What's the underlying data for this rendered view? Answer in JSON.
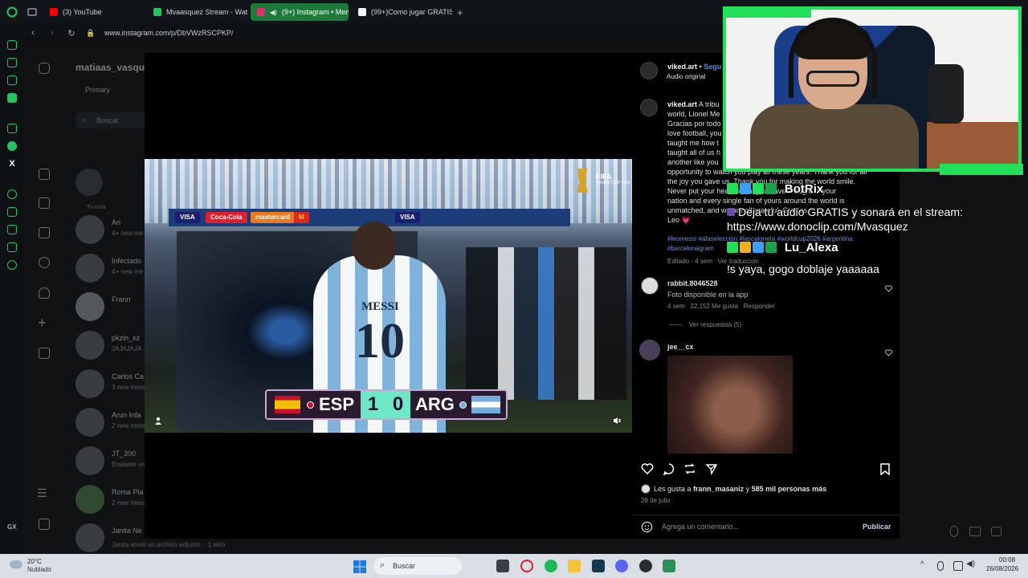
{
  "browser": {
    "tabs": [
      {
        "label": "(3) YouTube",
        "color": "#ff0000"
      },
      {
        "label": "Mvaasquez Stream - Watc",
        "color": "#22c55e"
      },
      {
        "label": "(9+) Instagram • Mens",
        "color": "#e1306c"
      },
      {
        "label": "(99+)Como jugar GRATIS a",
        "color": "#ffffff"
      }
    ],
    "new_tab": "+",
    "url": "www.instagram.com/p/DbVWzRSCPKP/",
    "gx_label": "GX"
  },
  "instagram_bg": {
    "username": "matiaas_vasqu",
    "primary_tab": "Primary",
    "search_placeholder": "Buscar",
    "note_label": "Tu nota",
    "conversations": [
      {
        "name": "Ari",
        "sub": "4+ new me"
      },
      {
        "name": "Infectado",
        "sub": "4+ new me"
      },
      {
        "name": "Frann",
        "sub": ""
      },
      {
        "name": "pkzin_xz",
        "sub": "JAJAJAJA"
      },
      {
        "name": "Carlos Ca",
        "sub": "3 new mess"
      },
      {
        "name": "Arun Infa",
        "sub": "2 new mess"
      },
      {
        "name": "JT_300",
        "sub": "Enviaste un"
      },
      {
        "name": "Roma Pla",
        "sub": "2 new mess"
      },
      {
        "name": "Janita Ne",
        "sub": ""
      }
    ],
    "bottom_text": "Janita envió un archivo adjunto. · 1 sem"
  },
  "video": {
    "ads": [
      "VISA",
      "Coca-Cola",
      "mastercard",
      "M",
      "VISA"
    ],
    "jersey_name": "MESSI",
    "jersey_number": "10",
    "fifa_logo": "FIFA",
    "fifa_sub": "WORLD CUP 2026",
    "scoreboard": {
      "home": "ESP",
      "away": "ARG",
      "home_score": "1",
      "away_score": "0"
    }
  },
  "post": {
    "author": "viked.art",
    "follow_label": "Segu",
    "audio": "Audio original",
    "caption_user": "viked.art",
    "caption_lines": [
      "A tribu",
      "world, Lionel Me",
      "Gracias por todo",
      "love football, you",
      "taught me how t",
      "taught all of us h",
      "another like you",
      "opportunity to watch you play all these years. Thank you for all",
      "the joy you gave us. Thank you for making the world smile.",
      "Never put your head down, you have brought to your",
      "nation and every single fan of yours around the world is",
      "unmatched, and we are all grateful. Gracias",
      "Leo 💗"
    ],
    "hashtags_line1": "#leomessi #afaseleccion #lascaloneta #worldcup2026 #argentina",
    "hashtags_line2": "#barcelonagram",
    "edited": "Editado · 4 sem",
    "translate": "Ver traducción",
    "comments": [
      {
        "user": "rabbit.8046528",
        "text": "Foto disponible en la app",
        "time": "4 sem",
        "likes": "22,152 Me gusta",
        "reply": "Responder",
        "view_replies": "Ver respuestas (5)"
      },
      {
        "user": "jee__cx"
      }
    ],
    "liked_by_prefix": "Les gusta a",
    "liked_by_user": "frann_masaniz",
    "liked_by_suffix": "y",
    "liked_by_count": "585 mil personas más",
    "date": "28 de julio",
    "comment_placeholder": "Agrega un comentario...",
    "publish": "Publicar"
  },
  "stream_overlay": {
    "chat": [
      {
        "type": "name",
        "text": "BotRix"
      },
      {
        "type": "msg",
        "text": "Deja tu audio GRATIS y sonará en el stream:"
      },
      {
        "type": "msg",
        "text": "https://www.donoclip.com/Mvasquez"
      },
      {
        "type": "name",
        "text": "Lu_Alexa"
      },
      {
        "type": "msg",
        "text": "!s yaya, gogo doblaje yaaaaaa"
      }
    ]
  },
  "taskbar": {
    "weather_temp": "20°C",
    "weather_desc": "Nublado",
    "search": "Buscar",
    "time": "00:08",
    "date": "26/08/2026"
  },
  "colors": {
    "accent": "#22c55e",
    "webcam_border": "#22e05a",
    "hashtag": "#6f8fd6",
    "score_box": "#6ee7c6"
  }
}
